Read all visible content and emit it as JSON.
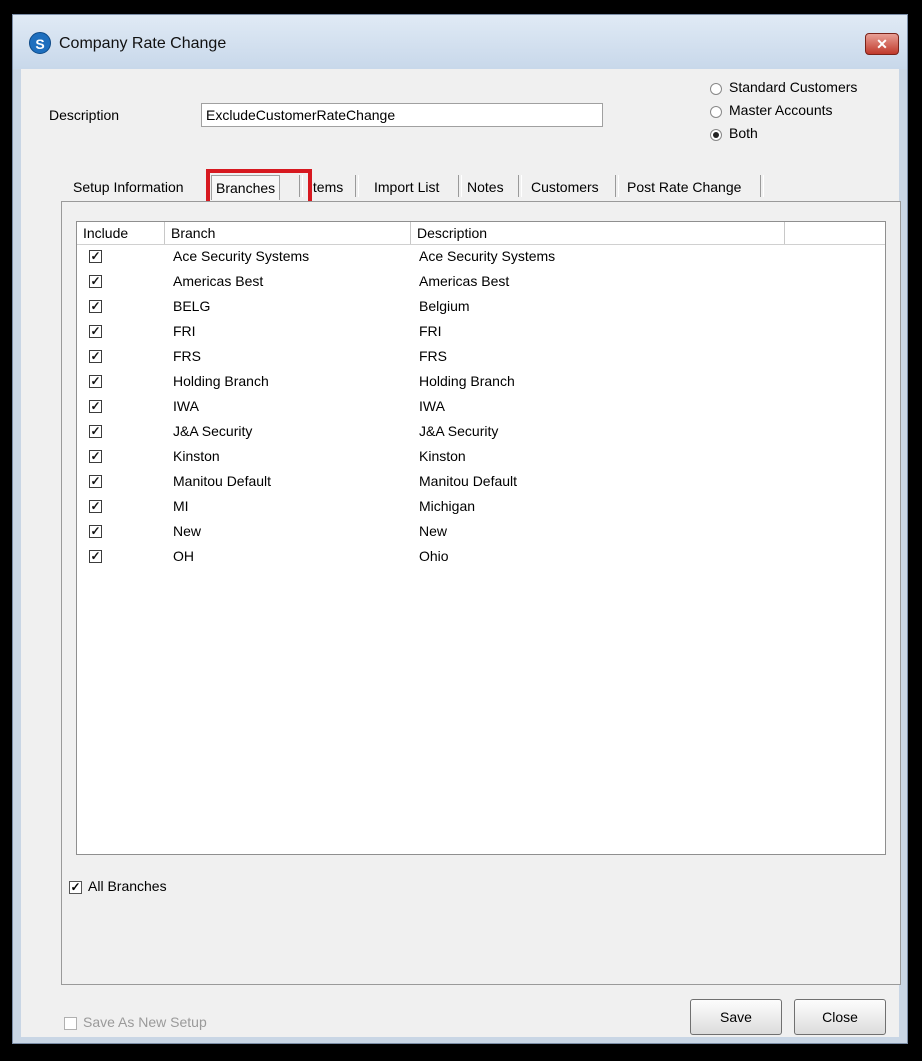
{
  "window": {
    "title": "Company Rate Change",
    "app_icon": "S"
  },
  "form": {
    "description_label": "Description",
    "description_value": "ExcludeCustomerRateChange",
    "customer_type": {
      "options": [
        "Standard Customers",
        "Master Accounts",
        "Both"
      ],
      "selected": "Both"
    }
  },
  "tabs": [
    "Setup Information",
    "Branches",
    "Items",
    "Import List",
    "Notes",
    "Customers",
    "Post Rate Change"
  ],
  "active_tab": "Branches",
  "branches_table": {
    "columns": [
      "Include",
      "Branch",
      "Description"
    ],
    "rows": [
      {
        "include": true,
        "branch": "Ace Security Systems",
        "description": "Ace Security Systems"
      },
      {
        "include": true,
        "branch": "Americas Best",
        "description": "Americas Best"
      },
      {
        "include": true,
        "branch": "BELG",
        "description": "Belgium"
      },
      {
        "include": true,
        "branch": "FRI",
        "description": "FRI"
      },
      {
        "include": true,
        "branch": "FRS",
        "description": "FRS"
      },
      {
        "include": true,
        "branch": "Holding Branch",
        "description": "Holding Branch"
      },
      {
        "include": true,
        "branch": "IWA",
        "description": "IWA"
      },
      {
        "include": true,
        "branch": "J&A Security",
        "description": "J&A Security"
      },
      {
        "include": true,
        "branch": "Kinston",
        "description": "Kinston"
      },
      {
        "include": true,
        "branch": "Manitou Default",
        "description": "Manitou Default"
      },
      {
        "include": true,
        "branch": "MI",
        "description": "Michigan"
      },
      {
        "include": true,
        "branch": "New",
        "description": "New"
      },
      {
        "include": true,
        "branch": "OH",
        "description": "Ohio"
      }
    ]
  },
  "all_branches": {
    "label": "All Branches",
    "checked": true
  },
  "footer": {
    "save_as_new_label": "Save As New Setup",
    "save_label": "Save",
    "close_label": "Close"
  },
  "colors": {
    "highlight": "#d71920",
    "titlebar": "#c8d8ea"
  }
}
